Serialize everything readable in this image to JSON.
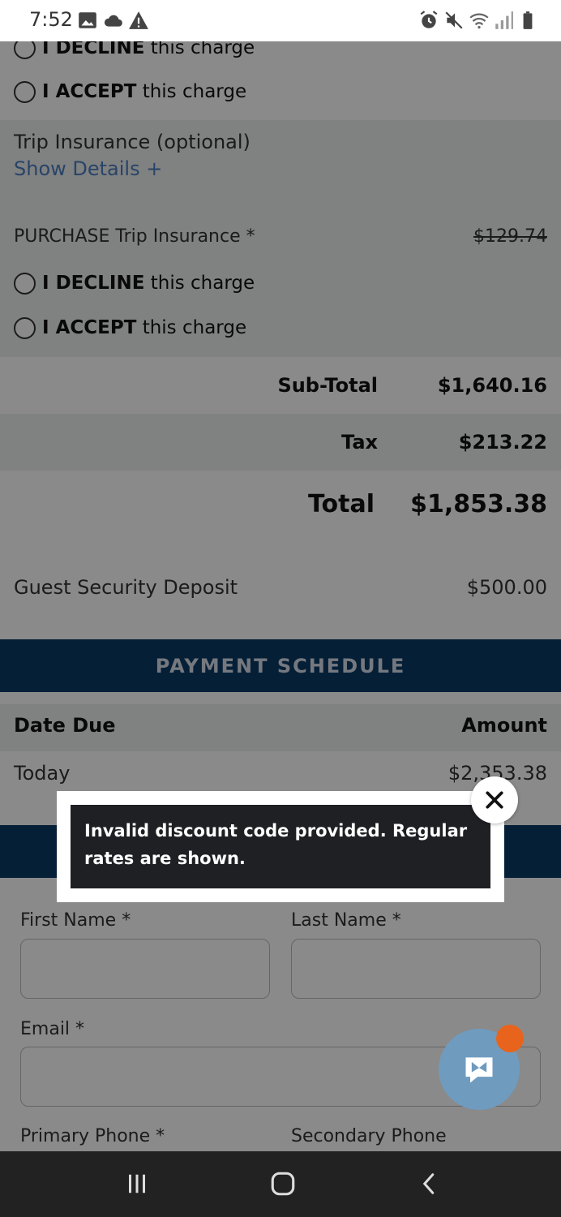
{
  "status_bar": {
    "time": "7:52",
    "icons": [
      "image-icon",
      "cloud-icon",
      "warning-icon",
      "alarm-icon",
      "mute-icon",
      "wifi-icon",
      "signal-icon",
      "battery-icon"
    ]
  },
  "cancellation": {
    "decline_prefix": "I DECLINE",
    "decline_suffix": " this charge",
    "accept_prefix": "I ACCEPT",
    "accept_suffix": " this charge"
  },
  "trip_insurance": {
    "title": "Trip Insurance (optional)",
    "show_details": "Show Details +",
    "purchase_label": "PURCHASE Trip Insurance *",
    "price": "$129.74",
    "decline_prefix": "I DECLINE",
    "decline_suffix": " this charge",
    "accept_prefix": "I ACCEPT",
    "accept_suffix": " this charge"
  },
  "totals": {
    "subtotal_label": "Sub-Total",
    "subtotal_value": "$1,640.16",
    "tax_label": "Tax",
    "tax_value": "$213.22",
    "total_label": "Total",
    "total_value": "$1,853.38",
    "deposit_label": "Guest Security Deposit",
    "deposit_value": "$500.00"
  },
  "payment_schedule": {
    "title": "PAYMENT SCHEDULE",
    "col_date": "Date Due",
    "col_amount": "Amount",
    "row_date": "Today",
    "row_amount": "$2,353.38"
  },
  "form": {
    "first_name_label": "First Name *",
    "last_name_label": "Last Name *",
    "email_label": "Email *",
    "primary_phone_label": "Primary Phone *",
    "secondary_phone_label": "Secondary Phone"
  },
  "toast": {
    "message": "Invalid discount code provided. Regular rates are shown."
  },
  "colors": {
    "navy": "#0b3a66",
    "link": "#4b7fc0",
    "badge": "#e8641d",
    "chat": "#6f9bbf"
  }
}
